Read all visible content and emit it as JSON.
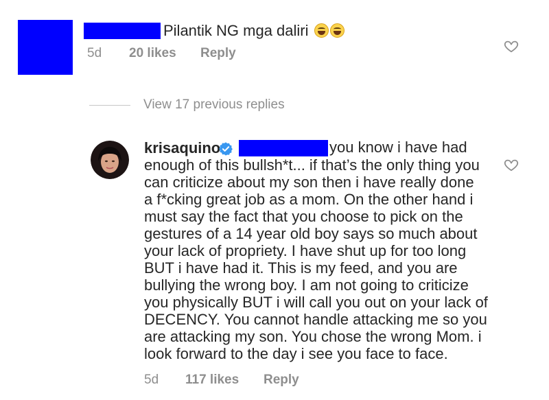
{
  "comment1": {
    "text": "Pilantik NG mga daliri",
    "emojis": [
      "laughing-face",
      "laughing-face"
    ],
    "time": "5d",
    "likes": "20 likes",
    "reply": "Reply",
    "redaction_color": "#0000ff"
  },
  "view_replies": "View 17 previous replies",
  "comment2": {
    "username": "krisaquino",
    "verified": true,
    "lines": [
      "you know i have had",
      "enough of this bullsh*t... if that’s the only thing you",
      "can criticize about my son then i have really done",
      "a f*cking great job as a mom. On the other hand i",
      "must say the fact that you choose to pick on the",
      "gestures of a 14 year old boy says so much about",
      "your lack of propriety. I have shut up for too long",
      "BUT i have had it. This is my feed, and you are",
      "bullying the wrong boy. I am not going to criticize",
      "you physically BUT i will call you out on your lack of",
      "DECENCY. You cannot handle attacking me so you",
      "are attacking my son. You chose the wrong Mom. i",
      "look forward to the day i see you face to face."
    ],
    "time": "5d",
    "likes": "117 likes",
    "reply": "Reply",
    "verified_color": "#3897f0"
  },
  "colors": {
    "text": "#262626",
    "meta": "#8e8e8e",
    "redaction": "#0000ff"
  }
}
